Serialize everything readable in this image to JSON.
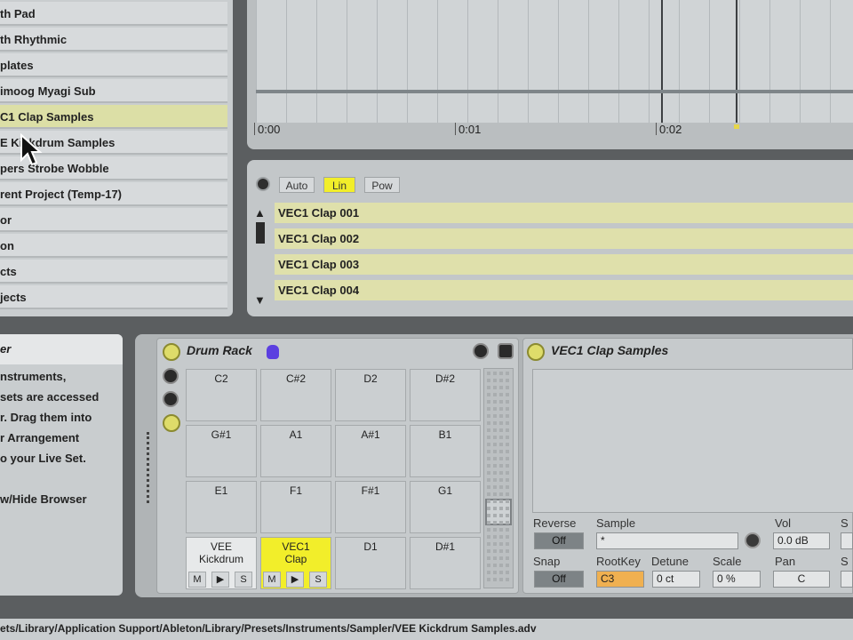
{
  "browser": {
    "items": [
      {
        "label": "th Pad",
        "selected": false
      },
      {
        "label": "th Rhythmic",
        "selected": false
      },
      {
        "label": "plates",
        "selected": false
      },
      {
        "label": "imoog Myagi Sub",
        "selected": false
      },
      {
        "label": "C1 Clap Samples",
        "selected": true
      },
      {
        "label": "E Kickdrum Samples",
        "selected": false
      },
      {
        "label": "pers Strobe Wobble",
        "selected": false
      },
      {
        "label": "rent Project (Temp-17)",
        "selected": false
      },
      {
        "label": "or",
        "selected": false
      },
      {
        "label": "on",
        "selected": false
      },
      {
        "label": "cts",
        "selected": false
      },
      {
        "label": "jects",
        "selected": false
      }
    ]
  },
  "timeline": {
    "ticks": [
      "0:00",
      "0:01",
      "0:02"
    ]
  },
  "sample_list": {
    "modes": [
      "Auto",
      "Lin",
      "Pow"
    ],
    "active_mode": "Lin",
    "rows": [
      "VEC1 Clap 001",
      "VEC1 Clap 002",
      "VEC1 Clap 003",
      "VEC1 Clap 004"
    ],
    "up_arrow": "▲",
    "down_arrow": "▼"
  },
  "info": {
    "title": "er",
    "lines": [
      "nstruments,",
      "sets are accessed",
      "r. Drag them into",
      "r Arrangement",
      "o your Live Set.",
      "",
      "w/Hide Browser"
    ]
  },
  "drum_rack": {
    "title": "Drum Rack",
    "pads": [
      {
        "note": "C2"
      },
      {
        "note": "C#2"
      },
      {
        "note": "D2"
      },
      {
        "note": "D#2"
      },
      {
        "note": "G#1"
      },
      {
        "note": "A1"
      },
      {
        "note": "A#1"
      },
      {
        "note": "B1"
      },
      {
        "note": "E1"
      },
      {
        "note": "F1"
      },
      {
        "note": "F#1"
      },
      {
        "note": "G1"
      },
      {
        "note": "VEE Kickdrum",
        "filled": true
      },
      {
        "note": "VEC1 Clap",
        "active": true
      },
      {
        "note": "D1"
      },
      {
        "note": "D#1"
      }
    ],
    "pad_controls": [
      "M",
      "▶",
      "S"
    ],
    "accent": "#f2ee2a"
  },
  "sampler": {
    "title": "VEC1 Clap Samples",
    "reverse_label": "Reverse",
    "reverse_value": "Off",
    "sample_label": "Sample",
    "sample_value": "*",
    "vol_label": "Vol",
    "vol_value": "0.0 dB",
    "snap_label": "Snap",
    "snap_value": "Off",
    "rootkey_label": "RootKey",
    "rootkey_value": "C3",
    "detune_label": "Detune",
    "detune_value": "0 ct",
    "scale_label": "Scale",
    "scale_value": "0 %",
    "pan_label": "Pan",
    "pan_value": "C",
    "cut_label_1": "S",
    "cut_label_2": "S"
  },
  "status_bar": {
    "path": "ets/Library/Application Support/Ableton/Library/Presets/Instruments/Sampler/VEE Kickdrum Samples.adv"
  }
}
